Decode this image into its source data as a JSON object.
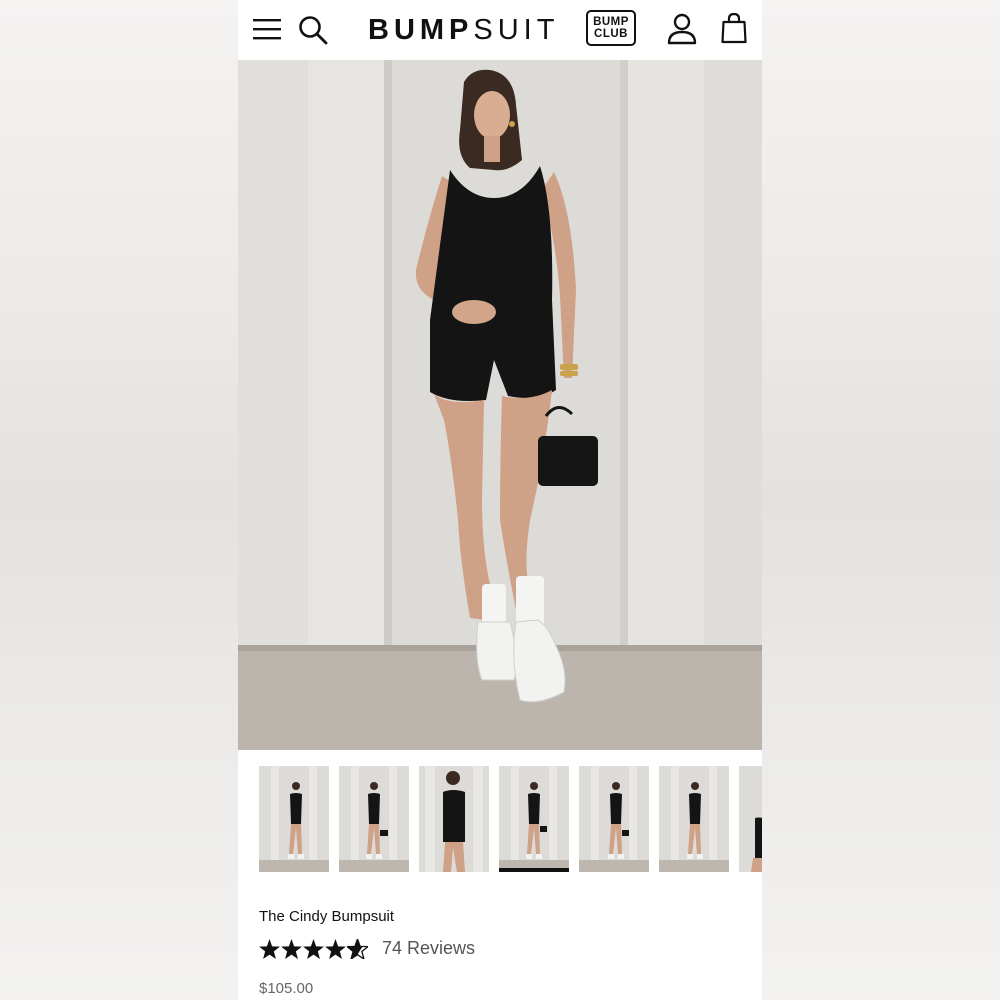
{
  "header": {
    "logo_bold": "BUMP",
    "logo_light": "SUIT",
    "club_line1": "BUMP",
    "club_line2": "CLUB"
  },
  "hero": {
    "image": "product-photo"
  },
  "thumbnails": {
    "count": 7,
    "active_index": 3
  },
  "product": {
    "title": "The Cindy Bumpsuit",
    "rating": 4.5,
    "reviews": "74 Reviews",
    "price": "$105.00"
  },
  "colors": {
    "text": "#111111",
    "muted": "#666666",
    "garment": "#141414",
    "wall": "#dddbd8"
  }
}
